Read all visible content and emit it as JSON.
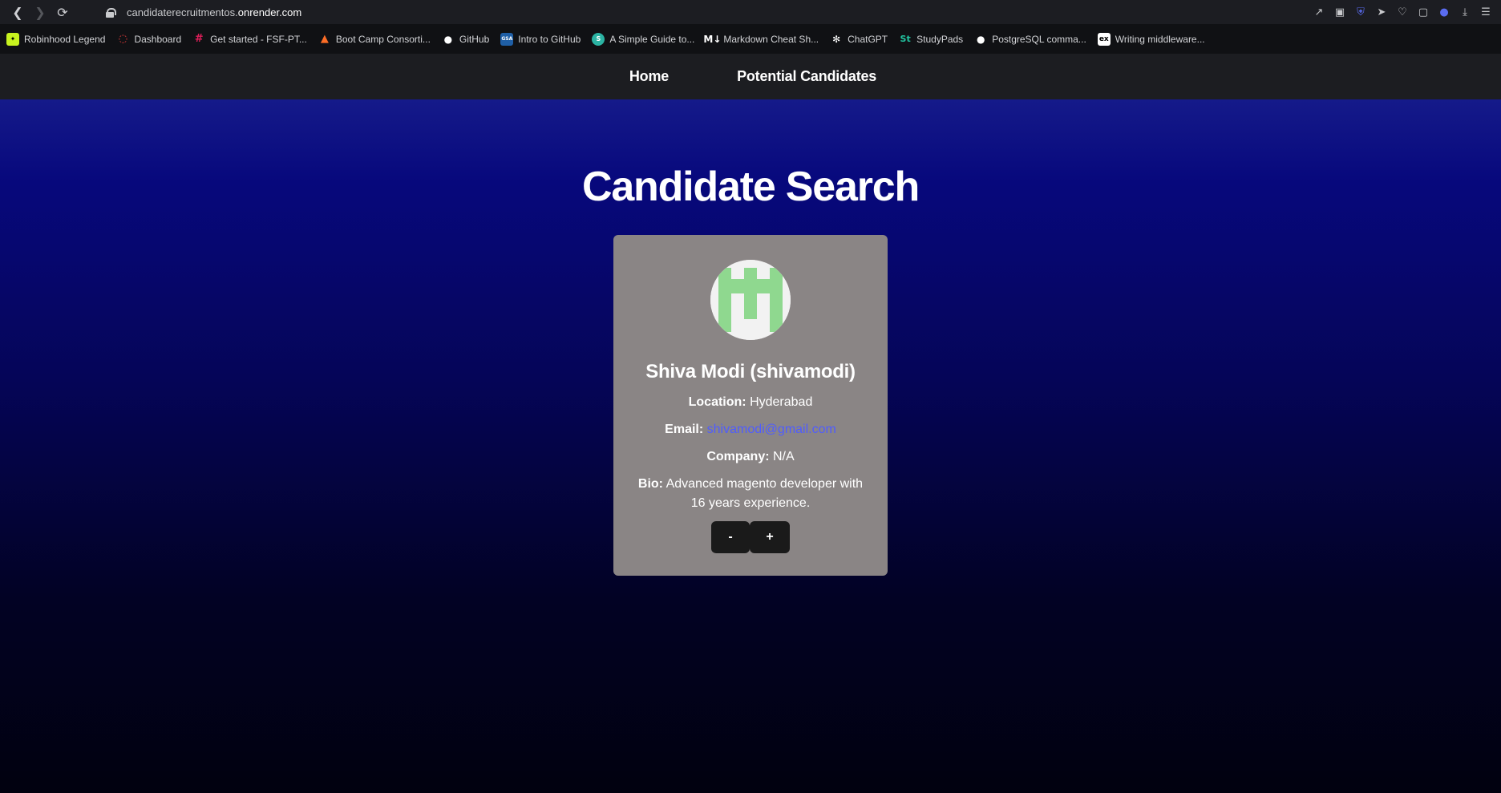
{
  "browser": {
    "url_prefix": "candidaterecruitmentos.",
    "url_host": "onrender.com",
    "icons": [
      "back-icon",
      "forward-icon",
      "reload-icon",
      "lock-icon",
      "share-icon",
      "screenshot-icon",
      "shield-icon",
      "send-icon",
      "heart-icon",
      "cube-icon",
      "profile-icon",
      "download-icon",
      "settings-icon"
    ]
  },
  "bookmarks": [
    {
      "label": "Robinhood Legend",
      "icon": "robinhood-icon",
      "color": "#c8f31f"
    },
    {
      "label": "Dashboard",
      "icon": "dashboard-icon",
      "color": "#e63b3b"
    },
    {
      "label": "Get started - FSF-PT...",
      "icon": "slack-icon",
      "color": "#e01e5a"
    },
    {
      "label": "Boot Camp Consorti...",
      "icon": "gitlab-icon",
      "color": "#fc6d26"
    },
    {
      "label": "GitHub",
      "icon": "github-icon",
      "color": "#ffffff"
    },
    {
      "label": "Intro to GitHub",
      "icon": "gsa-icon",
      "color": "#1f5fa6"
    },
    {
      "label": "A Simple Guide to...",
      "icon": "guide-icon",
      "color": "#2bb3a3"
    },
    {
      "label": "Markdown Cheat Sh...",
      "icon": "markdown-icon",
      "color": "#ffffff"
    },
    {
      "label": "ChatGPT",
      "icon": "chatgpt-icon",
      "color": "#ffffff"
    },
    {
      "label": "StudyPads",
      "icon": "studypads-icon",
      "color": "#22c3a0"
    },
    {
      "label": "PostgreSQL comma...",
      "icon": "github-icon",
      "color": "#ffffff"
    },
    {
      "label": "Writing middleware...",
      "icon": "express-icon",
      "color": "#ffffff"
    }
  ],
  "nav": {
    "home": "Home",
    "potential": "Potential Candidates"
  },
  "page": {
    "title": "Candidate Search"
  },
  "candidate": {
    "name": "Shiva Modi (shivamodi)",
    "location_label": "Location:",
    "location": "Hyderabad",
    "email_label": "Email:",
    "email": "shivamodi@gmail.com",
    "company_label": "Company:",
    "company": "N/A",
    "bio_label": "Bio:",
    "bio": "Advanced magento developer with 16 years experience.",
    "avatar_color": "#8fd88f"
  },
  "buttons": {
    "minus": "-",
    "plus": "+"
  }
}
